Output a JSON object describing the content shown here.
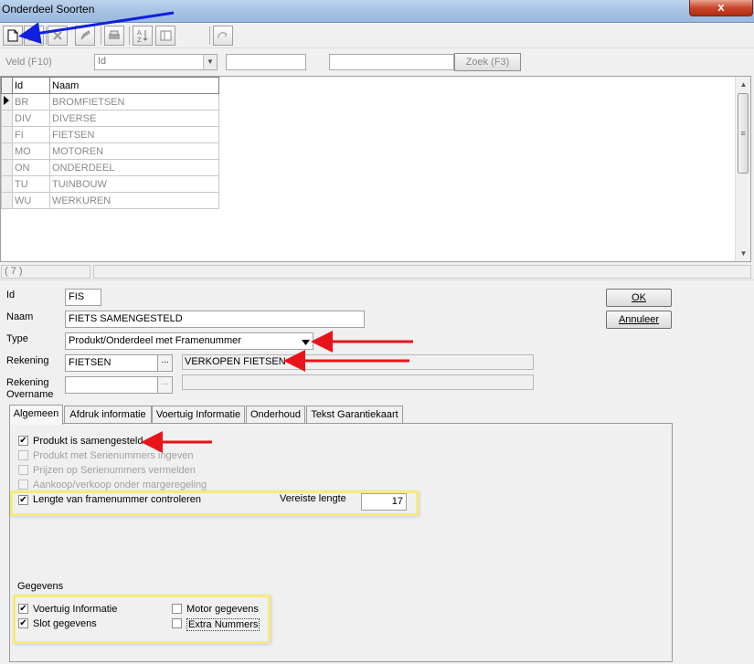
{
  "window": {
    "title": "Onderdeel Soorten",
    "close_label": "x"
  },
  "searchbar": {
    "field_label": "Veld (F10)",
    "field_value": "Id",
    "value1": "",
    "value2": "",
    "search_button": "Zoek (F3)"
  },
  "grid": {
    "columns": [
      "Id",
      "Naam"
    ],
    "rows": [
      [
        "BR",
        "BROMFIETSEN"
      ],
      [
        "DIV",
        "DIVERSE"
      ],
      [
        "FI",
        "FIETSEN"
      ],
      [
        "MO",
        "MOTOREN"
      ],
      [
        "ON",
        "ONDERDEEL"
      ],
      [
        "TU",
        "TUINBOUW"
      ],
      [
        "WU",
        "WERKUREN"
      ]
    ]
  },
  "status": {
    "count": "( 7 )"
  },
  "form": {
    "id_label": "Id",
    "id_value": "FIS",
    "naam_label": "Naam",
    "naam_value": "FIETS SAMENGESTELD",
    "type_label": "Type",
    "type_value": "Produkt/Onderdeel met Framenummer",
    "rekening_label": "Rekening",
    "rekening_value": "FIETSEN",
    "rekening_desc": "VERKOPEN FIETSEN",
    "overname_label_1": "Rekening",
    "overname_label_2": "Overname",
    "overname_value": "",
    "overname_desc": "",
    "ok_label": "OK",
    "annuleer_label": "Annuleer"
  },
  "tabs": [
    "Algemeen",
    "Afdruk informatie",
    "Voertuig Informatie",
    "Onderhoud",
    "Tekst Garantiekaart"
  ],
  "algemeen": {
    "opt_samengesteld": "Produkt is samengesteld",
    "opt_serienummers": "Produkt met Serienummers ingeven",
    "opt_prijzen": "Prijzen op Serienummers vermelden",
    "opt_marge": "Aankoop/verkoop onder margeregeling",
    "opt_lengte": "Lengte van framenummer controleren",
    "vereiste_label": "Vereiste lengte",
    "vereiste_value": "17",
    "gegevens_label": "Gegevens",
    "opt_voertuig": "Voertuig Informatie",
    "opt_slot": "Slot gegevens",
    "opt_motor": "Motor gegevens",
    "opt_extra": "Extra Nummers"
  },
  "colors": {
    "arrow_red": "#e8141a",
    "arrow_blue": "#1020e0",
    "highlight_yellow": "#f4ec7a"
  },
  "icons": {
    "toolbar": [
      "new-document-icon",
      "save-icon",
      "delete-icon",
      "edit-icon",
      "print-icon",
      "sort-az-icon",
      "columns-icon",
      "refresh-icon"
    ]
  }
}
